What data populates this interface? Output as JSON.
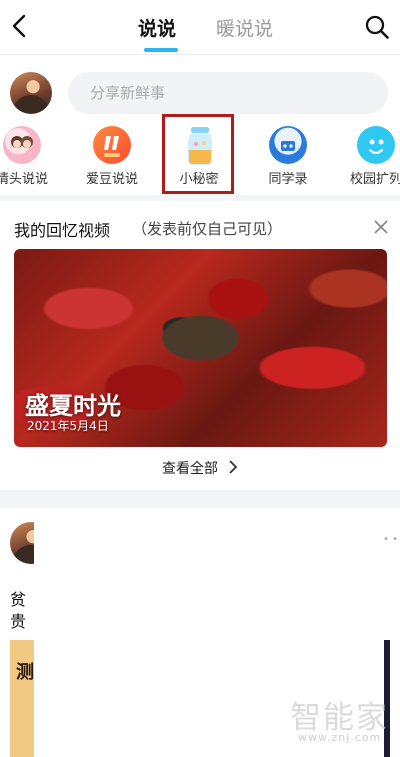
{
  "header": {
    "tabs": [
      {
        "label": "说说",
        "active": true
      },
      {
        "label": "暖说说",
        "active": false
      }
    ],
    "accent_color": "#27b6f2"
  },
  "compose": {
    "placeholder": "分享新鲜事"
  },
  "apps": [
    {
      "label": "情头说说",
      "icon": "couple-avatar-icon"
    },
    {
      "label": "爱豆说说",
      "icon": "idol-icon"
    },
    {
      "label": "小秘密",
      "icon": "secret-jar-icon",
      "highlighted": true
    },
    {
      "label": "同学录",
      "icon": "classmates-icon"
    },
    {
      "label": "校园扩列",
      "icon": "campus-icon"
    }
  ],
  "memory": {
    "title": "我的回忆视频",
    "subtitle": "（发表前仅自己可见）",
    "video_title": "盛夏时光",
    "video_date": "2021年5月4日",
    "view_all": "查看全部"
  },
  "post": {
    "line1": "贫",
    "line2": "贵",
    "image_text": "测"
  },
  "watermark": {
    "text": "智能家",
    "url": "www.znj.com"
  }
}
